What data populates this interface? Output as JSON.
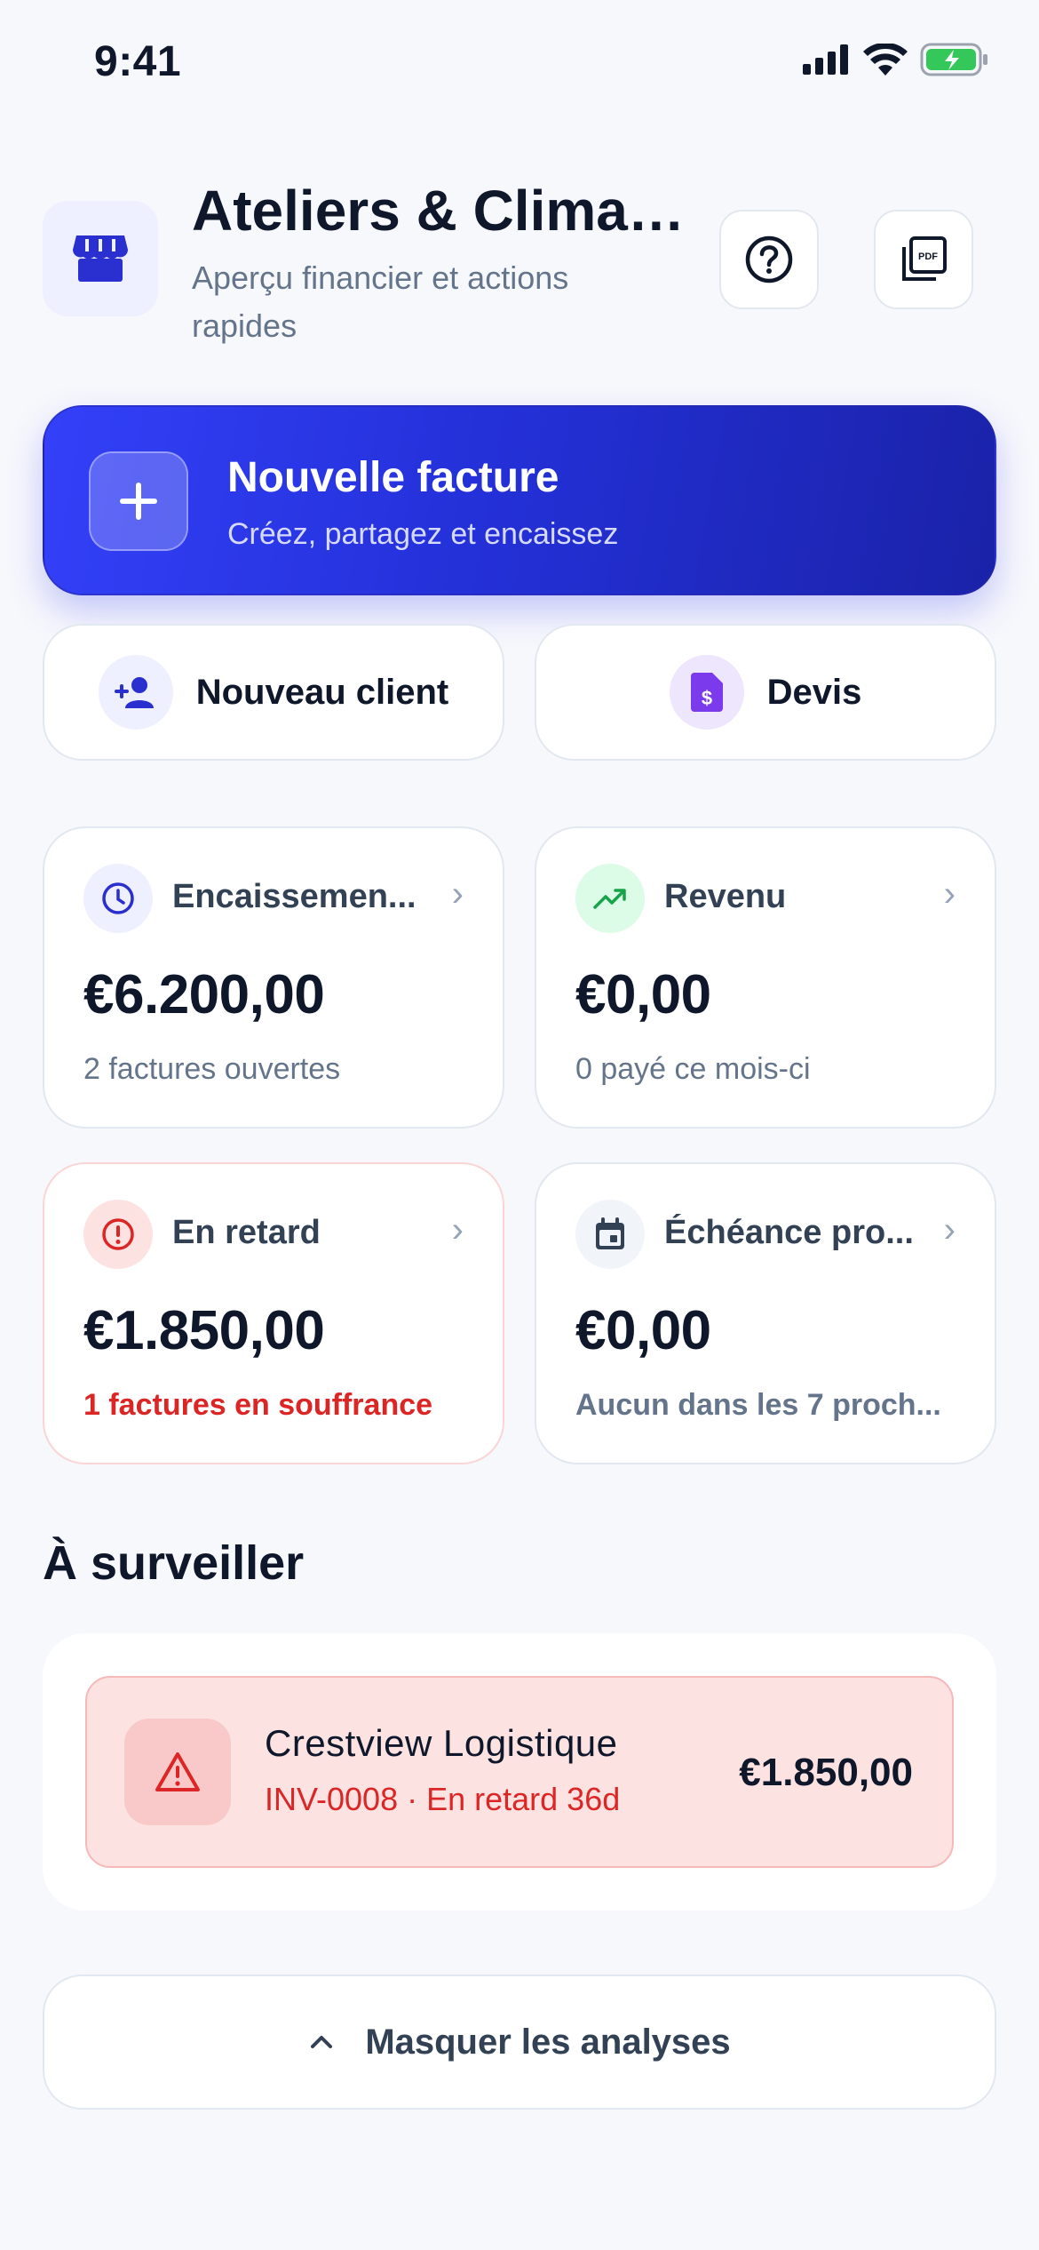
{
  "status_bar": {
    "time": "9:41"
  },
  "header": {
    "business_name": "Ateliers & Clima…",
    "subtitle": "Aperçu financier et actions rapides",
    "store_icon": "storefront-icon",
    "help_icon": "help-circle-icon",
    "pdf_icon": "pdf-icon"
  },
  "primary_action": {
    "title": "Nouvelle facture",
    "subtitle": "Créez, partagez et encaissez",
    "icon": "plus-icon"
  },
  "secondary_actions": [
    {
      "label": "Nouveau client",
      "icon": "person-add-icon"
    },
    {
      "label": "Devis",
      "icon": "document-dollar-icon"
    }
  ],
  "stats": [
    {
      "label": "Encaissemen...",
      "value": "€6.200,00",
      "footer": "2 factures ouvertes",
      "icon": "clock-icon"
    },
    {
      "label": "Revenu",
      "value": "€0,00",
      "footer": "0 payé ce mois-ci",
      "icon": "trending-up-icon"
    },
    {
      "label": "En retard",
      "value": "€1.850,00",
      "footer": "1 factures en souffrance",
      "icon": "alert-circle-icon"
    },
    {
      "label": "Échéance pro...",
      "value": "€0,00",
      "footer": "Aucun dans les 7 proch...",
      "icon": "calendar-icon"
    }
  ],
  "watch": {
    "section_title": "À surveiller",
    "items": [
      {
        "client": "Crestview Logistique",
        "meta": "INV-0008 · En retard 36d",
        "amount": "€1.850,00",
        "icon": "warning-triangle-icon"
      }
    ]
  },
  "toggle_analytics": {
    "label": "Masquer les analyses",
    "icon": "chevron-up-icon"
  },
  "colors": {
    "accent": "#2F3CF0",
    "danger": "#DC2626",
    "success": "#16A34A",
    "purple": "#7C3AED",
    "background": "#F7F8FC"
  }
}
